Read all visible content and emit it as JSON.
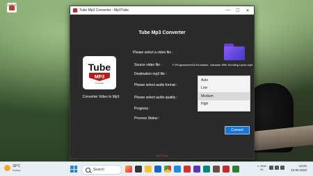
{
  "desktop": {
    "icon_label": "YouTube"
  },
  "window": {
    "title": "Tube Mp3 Converter - Mp3Tube",
    "controls": {
      "minimize": "—",
      "maximize": "☐",
      "close": "✕"
    },
    "heading": "Tube Mp3 Converter",
    "logo": {
      "line1": "Tube",
      "line2": "MP3",
      "line3": "converter"
    },
    "caption": "Converter Video to Mp3",
    "labels": {
      "select_video": "Please select a video file :",
      "source_video": "Source video file :",
      "destination": "Destination mp3 file :",
      "audio_format": "Please select audio format :",
      "audio_quality": "Please select audio quality :",
      "progress": "Progress :",
      "process_status": "Process Status :"
    },
    "source_path": "F:\\Programmer\\Dil Ka Aalam - Karaoke With Scrolling Lyrics.mp4",
    "quality_dropdown": {
      "options": [
        "Auto",
        "Low",
        "Medium",
        "High"
      ],
      "selected": "Medium"
    },
    "convert_button": "Convert",
    "footer_link": "Mp3Tube"
  },
  "taskbar": {
    "weather_temp": "39°C",
    "weather_cond": "Sunny",
    "search_placeholder": "Search",
    "lang_top": "ENG",
    "lang_bottom": "IN",
    "time": "13:22",
    "date": "13-06-2023"
  },
  "colors": {
    "window_bg": "#2b2b2b",
    "convert_button": "#1976d2",
    "footer_link": "#e53935",
    "folder": "#6a3fd4"
  }
}
